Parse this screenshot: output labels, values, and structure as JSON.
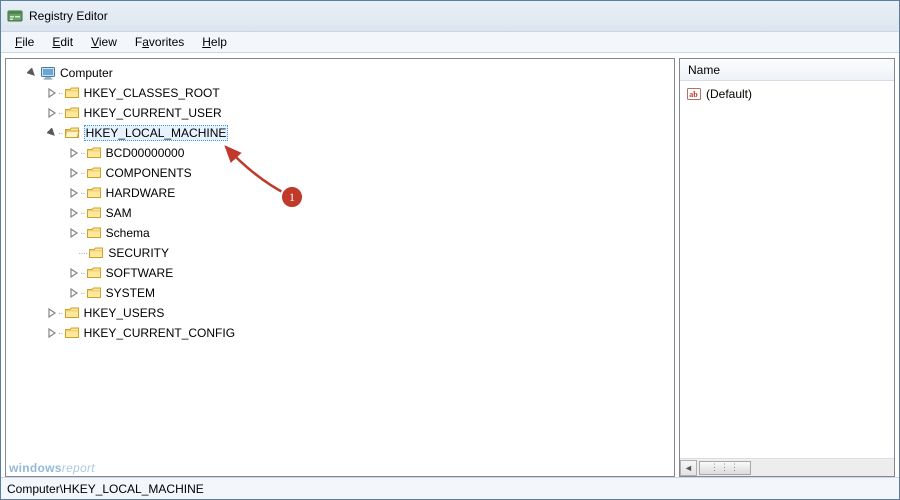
{
  "window": {
    "title": "Registry Editor"
  },
  "menu": {
    "file": "File",
    "edit": "Edit",
    "view": "View",
    "favorites": "Favorites",
    "help": "Help"
  },
  "tree": {
    "root": "Computer",
    "hives": {
      "classes_root": "HKEY_CLASSES_ROOT",
      "current_user": "HKEY_CURRENT_USER",
      "local_machine": "HKEY_LOCAL_MACHINE",
      "users": "HKEY_USERS",
      "current_config": "HKEY_CURRENT_CONFIG"
    },
    "hklm_children": {
      "bcd": "BCD00000000",
      "components": "COMPONENTS",
      "hardware": "HARDWARE",
      "sam": "SAM",
      "schema": "Schema",
      "security": "SECURITY",
      "software": "SOFTWARE",
      "system": "SYSTEM"
    }
  },
  "values": {
    "header_name": "Name",
    "default": "(Default)"
  },
  "status": {
    "path": "Computer\\HKEY_LOCAL_MACHINE"
  },
  "annotation": {
    "label": "1"
  },
  "watermark": {
    "w1": "windows",
    "w2": "report"
  }
}
